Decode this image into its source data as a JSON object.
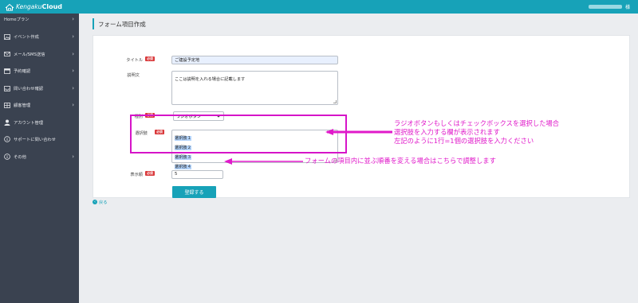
{
  "app": {
    "logo_text_1": "Kengaku",
    "logo_text_2": "Cloud",
    "user_suffix": "様"
  },
  "sidebar": {
    "items": [
      {
        "label": "Homeプラン",
        "icon": "none",
        "chevron": true
      },
      {
        "label": "イベント作成",
        "icon": "image-icon",
        "chevron": true
      },
      {
        "label": "メール/SMS送信",
        "icon": "mail-icon",
        "chevron": true
      },
      {
        "label": "予約確認",
        "icon": "calendar-icon",
        "chevron": true
      },
      {
        "label": "問い合わせ確認",
        "icon": "inbox-icon",
        "chevron": true
      },
      {
        "label": "顧客管理",
        "icon": "grid-icon",
        "chevron": true
      },
      {
        "label": "アカウント管理",
        "icon": "user-icon",
        "chevron": false
      },
      {
        "label": "サポートに問い合わせ",
        "icon": "info-icon",
        "chevron": false
      },
      {
        "label": "その他",
        "icon": "info-icon",
        "chevron": true
      }
    ]
  },
  "page": {
    "title": "フォーム項目作成",
    "back_label": "戻る"
  },
  "form": {
    "required_badge": "必須",
    "title_label": "タイトル",
    "title_value": "ご建設予定地",
    "description_label": "説明文",
    "description_value": "ここは説明を入れる場合に記載します",
    "type_label": "種別",
    "type_value": "ラジオボタン",
    "choices_label": "選択肢",
    "choices_value": [
      "選択肢１",
      "選択肢２",
      "選択肢３",
      "選択肢４"
    ],
    "order_label": "表示順",
    "order_value": "5",
    "submit_label": "登録する"
  },
  "annotations": {
    "choices_note_1": "ラジオボタンもしくはチェックボックスを選択した場合",
    "choices_note_2": "選択肢を入力する欄が表示されます",
    "choices_note_3": "左記のように1行=1個の選択肢を入力ください",
    "order_note": "フォームの項目内に並ぶ順番を変える場合はこちらで調整します"
  },
  "colors": {
    "accent": "#17a2b8",
    "sidebar": "#3a4250",
    "required": "#d9383a",
    "annotation": "#e01aca"
  }
}
